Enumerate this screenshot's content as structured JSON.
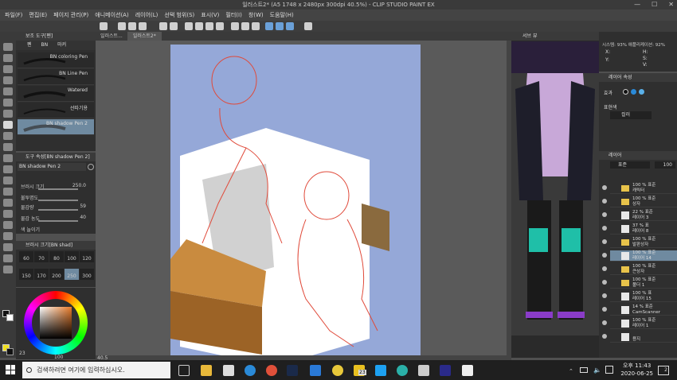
{
  "window": {
    "title": "일러스트2* (A5 1748 x 2480px 300dpi 40.5%) - CLIP STUDIO PAINT EX",
    "controls": [
      "—",
      "☐",
      "✕"
    ]
  },
  "menu": [
    "파일(F)",
    "편집(E)",
    "페이지 관리(P)",
    "애니메이션(A)",
    "레이어(L)",
    "선택 범위(S)",
    "표시(V)",
    "필터(I)",
    "창(W)",
    "도움말(H)"
  ],
  "canvas_tabs": [
    "일러스트...",
    "일러스트2*"
  ],
  "subtool": {
    "title": "보조 도구[펜]",
    "tabs": [
      "펜",
      "BN",
      "마커"
    ],
    "brushes": [
      "BN coloring Pen",
      "BN Line Pen",
      "Watered",
      "선따기용",
      "BN shadow Pen 2"
    ]
  },
  "tool_property": {
    "title": "도구 속성[BN shadow Pen 2]",
    "name": "BN shadow Pen 2",
    "rows": [
      {
        "label": "브러시 크기",
        "value": "250.0"
      },
      {
        "label": "불투명도",
        "value": ""
      },
      {
        "label": "물감량",
        "value": "59"
      },
      {
        "label": "물감 농도",
        "value": "40"
      },
      {
        "label": "색 늘이기",
        "value": ""
      }
    ]
  },
  "brush_size": {
    "title": "브러시 크기[BN shad]",
    "sizes": [
      "60",
      "70",
      "80",
      "100",
      "120",
      "150",
      "170",
      "200",
      "250",
      "300"
    ]
  },
  "color": {
    "title": "컬러써클",
    "readout": "23",
    "value": "100"
  },
  "canvas": {
    "zoom": "40.5",
    "background": "#95a8d8",
    "paper": "#ffffff"
  },
  "navigator": {
    "title": "서브 뷰"
  },
  "info": {
    "title": "정보",
    "lines": [
      "시스템: 93% 애플리케이션: 92%",
      "X:",
      "Y:",
      "H:",
      "S:",
      "V:"
    ]
  },
  "layer_property": {
    "title": "레이어 속성",
    "effect_label": "효과",
    "expression_label": "표현색",
    "expression_value": "컬러"
  },
  "layers": {
    "title": "레이어",
    "blend": "표준",
    "opacity": "100",
    "items": [
      {
        "mode": "100 % 표준",
        "name": "캐릭터",
        "type": "folder"
      },
      {
        "mode": "100 % 표준",
        "name": "상자",
        "type": "folder"
      },
      {
        "mode": "22 % 표준",
        "name": "레이어 3",
        "type": "layer"
      },
      {
        "mode": "37 % 표",
        "name": "레이어 8",
        "type": "layer"
      },
      {
        "mode": "100 % 표준",
        "name": "발판상자",
        "type": "folder"
      },
      {
        "mode": "100 % 표준",
        "name": "레이어 14",
        "type": "layer",
        "selected": true
      },
      {
        "mode": "100 % 표준",
        "name": "큰상자",
        "type": "folder"
      },
      {
        "mode": "100 % 표준",
        "name": "폴더 1",
        "type": "folder"
      },
      {
        "mode": "100 % 표",
        "name": "레이어 15",
        "type": "layer"
      },
      {
        "mode": "14 % 표준",
        "name": "CamScanner",
        "type": "layer"
      },
      {
        "mode": "100 % 표준",
        "name": "레이어 1",
        "type": "layer"
      },
      {
        "mode": "",
        "name": "용지",
        "type": "paper"
      }
    ]
  },
  "taskbar": {
    "search_placeholder": "검색하려면 여기에 입력하십시오.",
    "badge": "23",
    "time": "오후 11:43",
    "date": "2020-06-25",
    "notification_count": "2"
  }
}
